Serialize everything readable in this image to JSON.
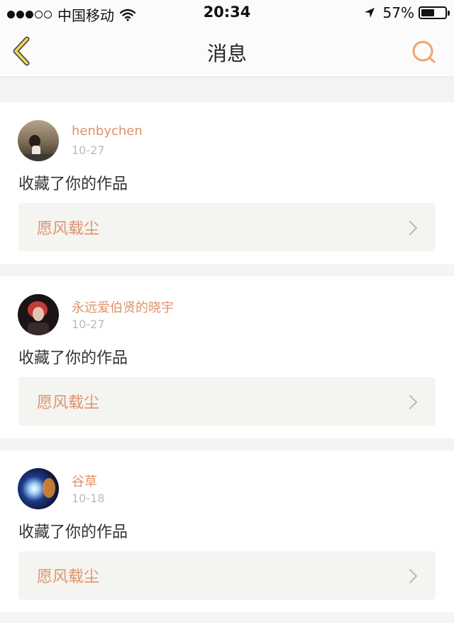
{
  "status_bar": {
    "carrier": "中国移动",
    "time": "20:34",
    "battery": "57%",
    "battery_level": 0.57,
    "signal_bars_filled": 3,
    "signal_bars_total": 5
  },
  "nav": {
    "title": "消息",
    "accent": "#f0a36f"
  },
  "messages": [
    {
      "username": "henbychen",
      "date": "10-27",
      "action": "收藏了你的作品",
      "work_title": "愿风载尘"
    },
    {
      "username": "永远爱伯贤的晓宇",
      "date": "10-27",
      "action": "收藏了你的作品",
      "work_title": "愿风载尘"
    },
    {
      "username": "谷草",
      "date": "10-18",
      "action": "收藏了你的作品",
      "work_title": "愿风载尘"
    }
  ],
  "colors": {
    "username": "#e0926a",
    "work_title": "#e0926a",
    "date": "#bbbbbb",
    "card_bg": "#ffffff",
    "page_bg": "#f4f4f2",
    "work_bg": "#f4f4f0"
  },
  "icons": {
    "back": "chevron-left-icon",
    "search": "search-icon",
    "work_arrow": "chevron-right-icon"
  }
}
